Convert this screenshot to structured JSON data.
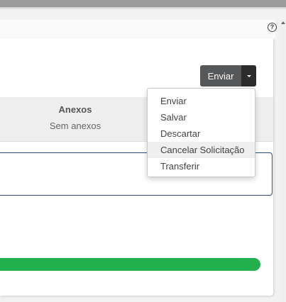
{
  "header": {
    "help_icon": "question-circle-icon",
    "help_glyph": "?"
  },
  "actions": {
    "send_label": "Enviar",
    "menu_items": [
      "Enviar",
      "Salvar",
      "Descartar",
      "Cancelar Solicitação",
      "Transferir"
    ],
    "highlighted_item": "Cancelar Solicitação"
  },
  "attachments": {
    "title": "Anexos",
    "value": "Sem anexos"
  },
  "progress": {
    "percent": 100,
    "color": "#21b04b"
  },
  "colors": {
    "send_button": "#555759",
    "caret_button": "#2b2b2b",
    "box_border": "#2c4a7a"
  }
}
